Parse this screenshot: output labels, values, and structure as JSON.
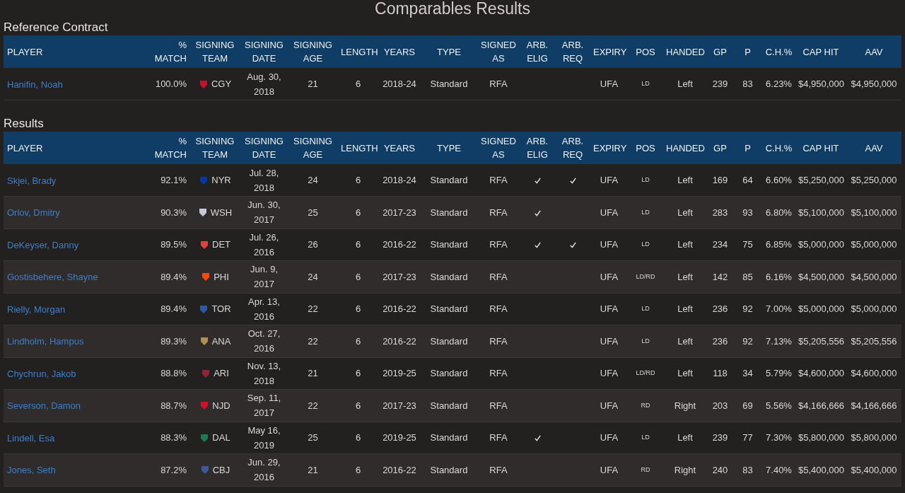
{
  "title": "Comparables Results",
  "sections": [
    {
      "heading": "Reference Contract",
      "columns": [
        "PLAYER",
        "% MATCH",
        "SIGNING TEAM",
        "SIGNING DATE",
        "SIGNING AGE",
        "LENGTH",
        "YEARS",
        "TYPE",
        "SIGNED AS",
        "ARB. ELIG",
        "ARB. REQ",
        "EXPIRY",
        "POS",
        "HANDED",
        "GP",
        "P",
        "C.H.%",
        "CAP HIT",
        "AAV"
      ],
      "rows": [
        {
          "player": "Hanifin, Noah",
          "match": "100.0%",
          "team": "CGY",
          "color": "#c8102e",
          "date": "Aug. 30, 2018",
          "age": "21",
          "length": "6",
          "years": "2018-24",
          "type": "Standard",
          "signed_as": "RFA",
          "arb_elig": false,
          "arb_req": false,
          "expiry": "UFA",
          "pos": "LD",
          "handed": "Left",
          "gp": "239",
          "p": "83",
          "ch": "6.23%",
          "cap_hit": "$4,950,000",
          "aav": "$4,950,000"
        }
      ]
    },
    {
      "heading": "Results",
      "columns": [
        "PLAYER",
        "% MATCH",
        "SIGNING TEAM",
        "SIGNING DATE",
        "SIGNING AGE",
        "LENGTH",
        "YEARS",
        "TYPE",
        "SIGNED AS",
        "ARB. ELIG",
        "ARB. REQ",
        "EXPIRY",
        "POS",
        "HANDED",
        "GP",
        "P",
        "C.H.%",
        "CAP HIT",
        "AAV"
      ],
      "rows": [
        {
          "player": "Skjei, Brady",
          "match": "92.1%",
          "team": "NYR",
          "color": "#0038a8",
          "date": "Jul. 28, 2018",
          "age": "24",
          "length": "6",
          "years": "2018-24",
          "type": "Standard",
          "signed_as": "RFA",
          "arb_elig": true,
          "arb_req": true,
          "expiry": "UFA",
          "pos": "LD",
          "handed": "Left",
          "gp": "169",
          "p": "64",
          "ch": "6.60%",
          "cap_hit": "$5,250,000",
          "aav": "$5,250,000"
        },
        {
          "player": "Orlov, Dmitry",
          "match": "90.3%",
          "team": "WSH",
          "color": "#c8c8d8",
          "date": "Jun. 30, 2017",
          "age": "25",
          "length": "6",
          "years": "2017-23",
          "type": "Standard",
          "signed_as": "RFA",
          "arb_elig": true,
          "arb_req": false,
          "expiry": "UFA",
          "pos": "LD",
          "handed": "Left",
          "gp": "283",
          "p": "93",
          "ch": "6.80%",
          "cap_hit": "$5,100,000",
          "aav": "$5,100,000"
        },
        {
          "player": "DeKeyser, Danny",
          "match": "89.5%",
          "team": "DET",
          "color": "#e04040",
          "date": "Jul. 26, 2016",
          "age": "26",
          "length": "6",
          "years": "2016-22",
          "type": "Standard",
          "signed_as": "RFA",
          "arb_elig": true,
          "arb_req": true,
          "expiry": "UFA",
          "pos": "LD",
          "handed": "Left",
          "gp": "234",
          "p": "75",
          "ch": "6.85%",
          "cap_hit": "$5,000,000",
          "aav": "$5,000,000"
        },
        {
          "player": "Gostisbehere, Shayne",
          "match": "89.4%",
          "team": "PHI",
          "color": "#f74902",
          "date": "Jun. 9, 2017",
          "age": "24",
          "length": "6",
          "years": "2017-23",
          "type": "Standard",
          "signed_as": "RFA",
          "arb_elig": false,
          "arb_req": false,
          "expiry": "UFA",
          "pos": "LD/RD",
          "handed": "Left",
          "gp": "142",
          "p": "85",
          "ch": "6.16%",
          "cap_hit": "$4,500,000",
          "aav": "$4,500,000"
        },
        {
          "player": "Rielly, Morgan",
          "match": "89.4%",
          "team": "TOR",
          "color": "#2a5aa8",
          "date": "Apr. 13, 2016",
          "age": "22",
          "length": "6",
          "years": "2016-22",
          "type": "Standard",
          "signed_as": "RFA",
          "arb_elig": false,
          "arb_req": false,
          "expiry": "UFA",
          "pos": "LD",
          "handed": "Left",
          "gp": "236",
          "p": "92",
          "ch": "7.00%",
          "cap_hit": "$5,000,000",
          "aav": "$5,000,000"
        },
        {
          "player": "Lindholm, Hampus",
          "match": "89.3%",
          "team": "ANA",
          "color": "#b09050",
          "date": "Oct. 27, 2016",
          "age": "22",
          "length": "6",
          "years": "2016-22",
          "type": "Standard",
          "signed_as": "RFA",
          "arb_elig": false,
          "arb_req": false,
          "expiry": "UFA",
          "pos": "LD",
          "handed": "Left",
          "gp": "236",
          "p": "92",
          "ch": "7.13%",
          "cap_hit": "$5,205,556",
          "aav": "$5,205,556"
        },
        {
          "player": "Chychrun, Jakob",
          "match": "88.8%",
          "team": "ARI",
          "color": "#8c2633",
          "date": "Nov. 13, 2018",
          "age": "21",
          "length": "6",
          "years": "2019-25",
          "type": "Standard",
          "signed_as": "RFA",
          "arb_elig": false,
          "arb_req": false,
          "expiry": "UFA",
          "pos": "LD/RD",
          "handed": "Left",
          "gp": "118",
          "p": "34",
          "ch": "5.79%",
          "cap_hit": "$4,600,000",
          "aav": "$4,600,000"
        },
        {
          "player": "Severson, Damon",
          "match": "88.7%",
          "team": "NJD",
          "color": "#ce1126",
          "date": "Sep. 11, 2017",
          "age": "22",
          "length": "6",
          "years": "2017-23",
          "type": "Standard",
          "signed_as": "RFA",
          "arb_elig": false,
          "arb_req": false,
          "expiry": "UFA",
          "pos": "RD",
          "handed": "Right",
          "gp": "203",
          "p": "69",
          "ch": "5.56%",
          "cap_hit": "$4,166,666",
          "aav": "$4,166,666"
        },
        {
          "player": "Lindell, Esa",
          "match": "88.3%",
          "team": "DAL",
          "color": "#1a7a50",
          "date": "May 16, 2019",
          "age": "25",
          "length": "6",
          "years": "2019-25",
          "type": "Standard",
          "signed_as": "RFA",
          "arb_elig": true,
          "arb_req": false,
          "expiry": "UFA",
          "pos": "LD",
          "handed": "Left",
          "gp": "239",
          "p": "77",
          "ch": "7.30%",
          "cap_hit": "$5,800,000",
          "aav": "$5,800,000"
        },
        {
          "player": "Jones, Seth",
          "match": "87.2%",
          "team": "CBJ",
          "color": "#3a5a9a",
          "date": "Jun. 29, 2016",
          "age": "21",
          "length": "6",
          "years": "2016-22",
          "type": "Standard",
          "signed_as": "RFA",
          "arb_elig": false,
          "arb_req": false,
          "expiry": "UFA",
          "pos": "RD",
          "handed": "Right",
          "gp": "240",
          "p": "83",
          "ch": "7.40%",
          "cap_hit": "$5,400,000",
          "aav": "$5,400,000"
        }
      ]
    }
  ]
}
